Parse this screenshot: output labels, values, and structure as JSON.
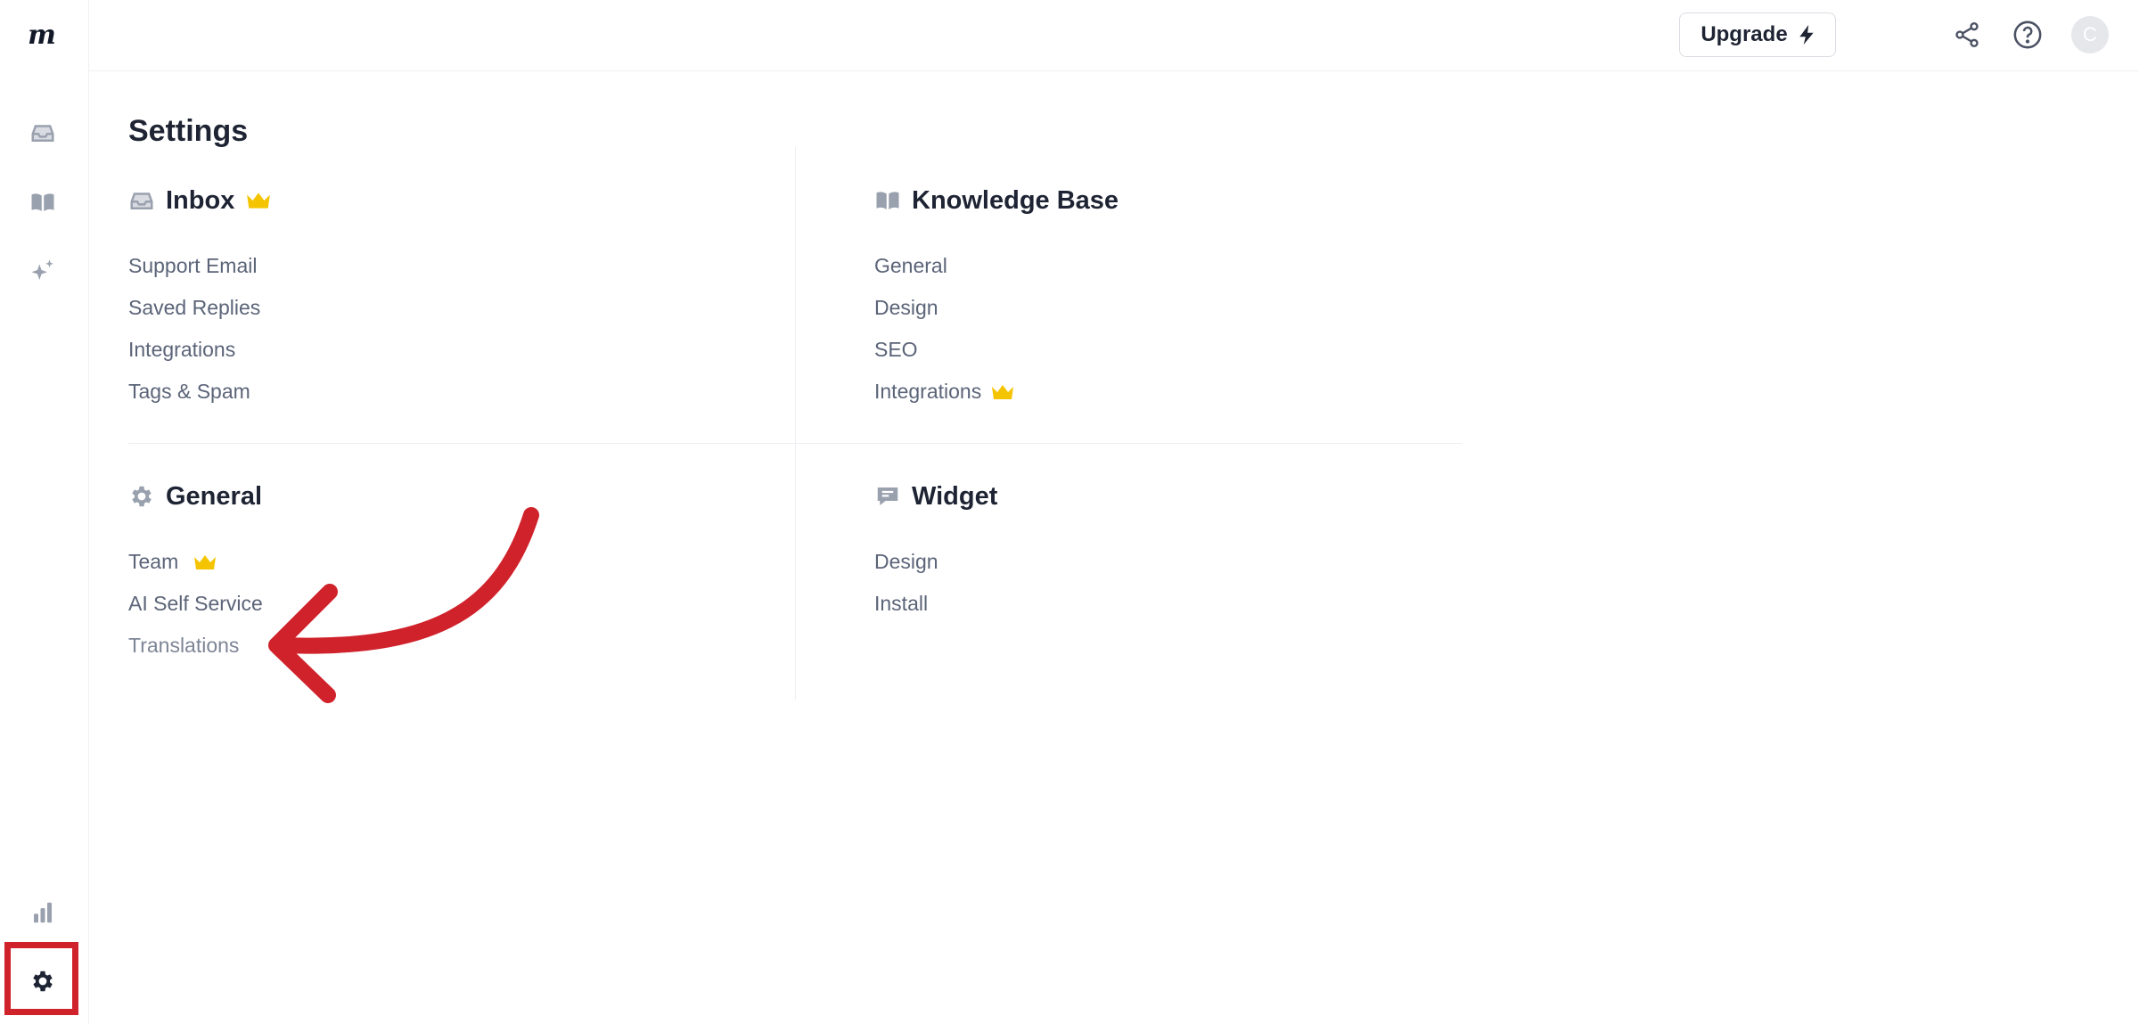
{
  "brand": {
    "logo_text": "m"
  },
  "sidebar": {
    "items": [
      {
        "icon": "inbox-icon"
      },
      {
        "icon": "book-icon"
      },
      {
        "icon": "sparkles-icon"
      },
      {
        "icon": "chart-icon"
      },
      {
        "icon": "gear-icon"
      }
    ]
  },
  "topbar": {
    "upgrade_label": "Upgrade",
    "avatar_initial": "C"
  },
  "page": {
    "title": "Settings"
  },
  "sections": {
    "inbox": {
      "title": "Inbox",
      "links": [
        "Support Email",
        "Saved Replies",
        "Integrations",
        "Tags & Spam"
      ]
    },
    "knowledge_base": {
      "title": "Knowledge Base",
      "links": [
        "General",
        "Design",
        "SEO",
        "Integrations"
      ]
    },
    "general": {
      "title": "General",
      "links": [
        "Team",
        "AI Self Service",
        "Translations"
      ]
    },
    "widget": {
      "title": "Widget",
      "links": [
        "Design",
        "Install"
      ]
    }
  },
  "colors": {
    "accent_red": "#d0222b",
    "crown_yellow": "#f5c400",
    "icon_gray": "#9aa1ae"
  }
}
